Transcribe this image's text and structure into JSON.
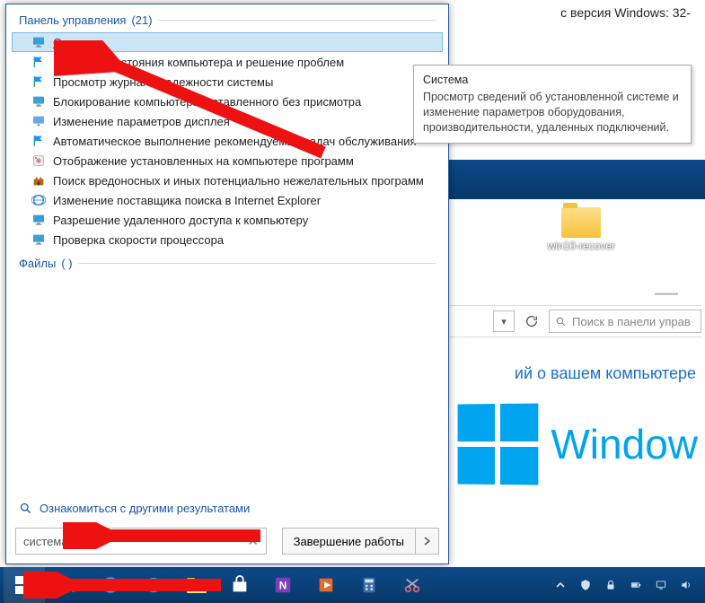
{
  "background": {
    "top_text": "с версия Windows: 32-",
    "nav_search_placeholder": "Поиск в панели управ",
    "about_link": "ий о вашем компьютере",
    "brand": "Window"
  },
  "desktop": {
    "folder_label": "win10-recover"
  },
  "panel": {
    "header": {
      "label": "Панель управления",
      "count": "(21)"
    },
    "files_header": {
      "label": "Файлы",
      "count": "(   )"
    },
    "more_results": "Ознакомиться с другими результатами",
    "search_value": "система",
    "shutdown_label": "Завершение работы"
  },
  "results": [
    {
      "icon": "monitor",
      "label": "Система",
      "hovered": true
    },
    {
      "icon": "flag",
      "label": "Проверка состояния компьютера и решение проблем"
    },
    {
      "icon": "flag",
      "label": "Просмотр журнала надежности системы"
    },
    {
      "icon": "monitor",
      "label": "Блокирование компьютера, оставленного без присмотра"
    },
    {
      "icon": "display",
      "label": "Изменение параметров дисплея"
    },
    {
      "icon": "flag",
      "label": "Автоматическое выполнение рекомендуемых задач обслуживания"
    },
    {
      "icon": "programs",
      "label": "Отображение установленных на компьютере программ"
    },
    {
      "icon": "castle",
      "label": "Поиск вредоносных и иных потенциально нежелательных программ"
    },
    {
      "icon": "globe",
      "label": "Изменение поставщика поиска в Internet Explorer"
    },
    {
      "icon": "monitor",
      "label": "Разрешение удаленного доступа к компьютеру"
    },
    {
      "icon": "monitor",
      "label": "Проверка скорости процессора"
    }
  ],
  "tooltip": {
    "title": "Система",
    "body": "Просмотр сведений об установленной системе и изменение параметров оборудования, производительности, удаленных подключений."
  },
  "icons": {
    "monitor": "monitor-icon",
    "flag": "flag-icon",
    "display": "display-icon",
    "programs": "programs-icon",
    "castle": "castle-icon",
    "globe": "globe-icon",
    "search": "search-icon",
    "clear": "clear-icon",
    "chevron": "chevron-right-icon",
    "refresh": "refresh-icon"
  }
}
